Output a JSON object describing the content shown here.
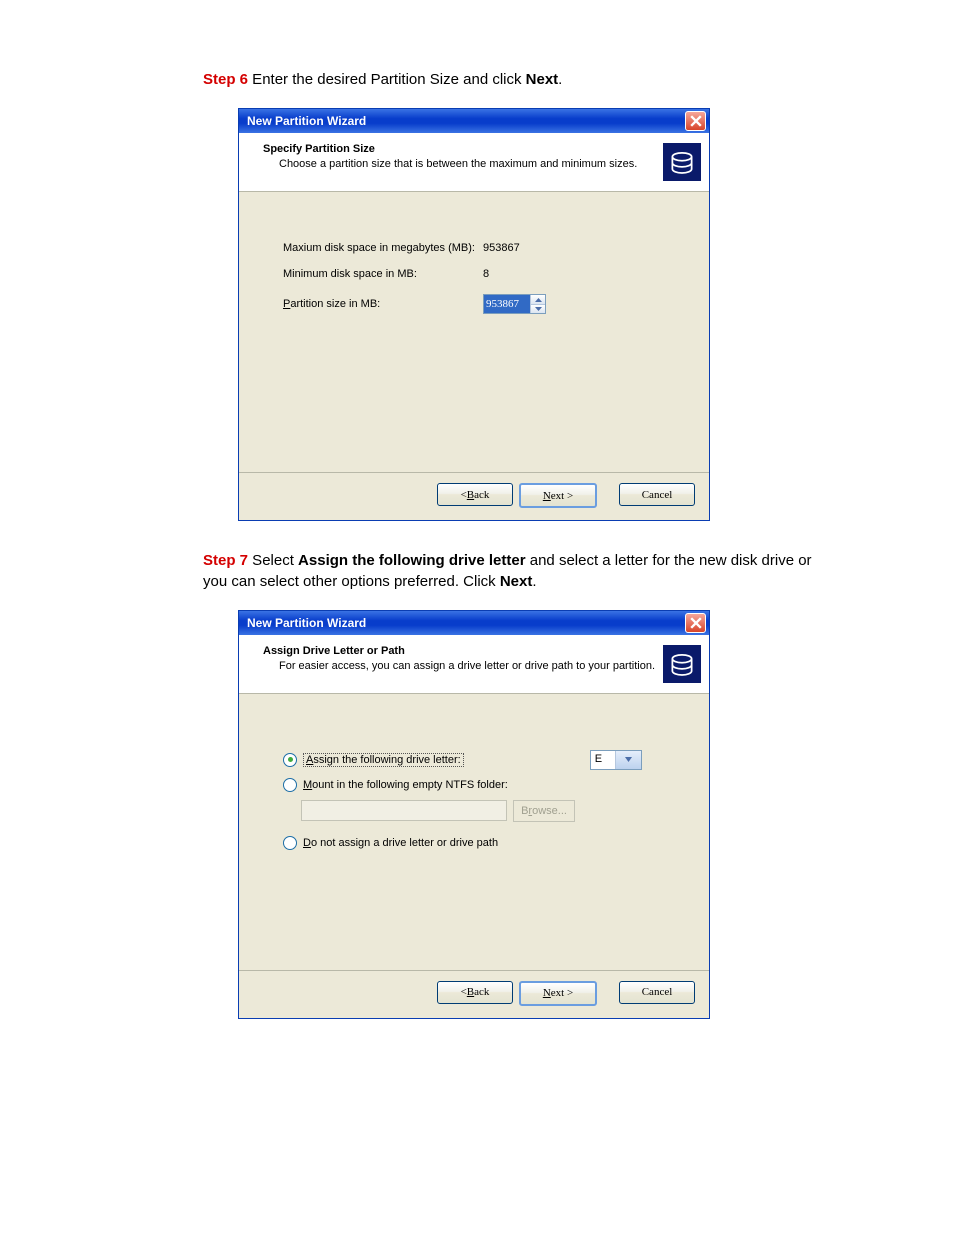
{
  "instructions": {
    "step6": {
      "label": "Step 6",
      "pre": " Enter the desired Partition Size and click ",
      "bold": "Next",
      "post": "."
    },
    "step7": {
      "label": "Step 7",
      "pre": " Select ",
      "bold1": "Assign the following drive letter",
      "mid": " and select a letter for the new disk drive or you can select other options preferred. Click ",
      "bold2": "Next",
      "post": "."
    }
  },
  "dialog1": {
    "title": "New Partition Wizard",
    "header": {
      "title": "Specify Partition Size",
      "sub": "Choose a partition size that is between the maximum and minimum sizes."
    },
    "max_label": "Maxium disk space in megabytes (MB):",
    "max_value": "953867",
    "min_label": "Minimum disk space in MB:",
    "min_value": "8",
    "size_label": "Partition size in MB:",
    "size_value": "953867",
    "back": "Back",
    "next": "Next >",
    "cancel": "Cancel"
  },
  "dialog2": {
    "title": "New Partition Wizard",
    "header": {
      "title": "Assign Drive Letter or Path",
      "sub": "For easier access, you can assign a drive letter or drive path to your partition."
    },
    "opt_assign": "Assign the following drive letter:",
    "drive_letter": "E",
    "opt_mount": "Mount in the following empty NTFS folder:",
    "browse": "Browse...",
    "opt_none": "Do not assign a drive letter or drive path",
    "back": "Back",
    "next": "Next >",
    "cancel": "Cancel"
  }
}
